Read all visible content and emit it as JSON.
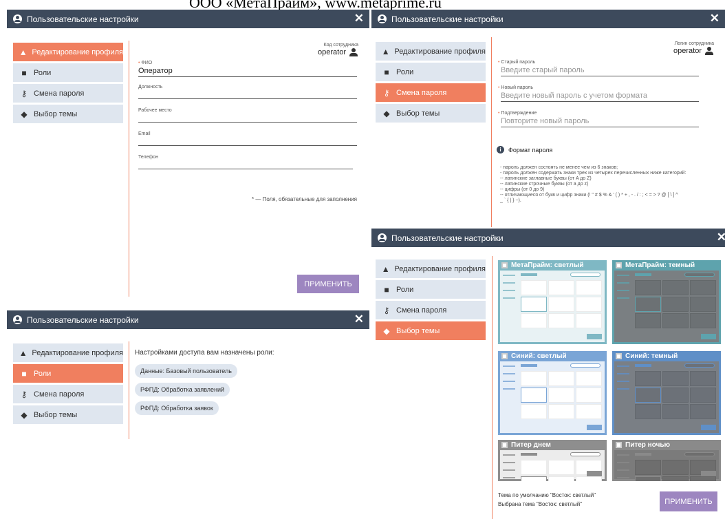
{
  "caption": "ООО «МетаПрайм», www.metaprime.ru",
  "window_title": "Пользовательские настройки",
  "menu": [
    "Редактирование профиля",
    "Роли",
    "Смена пароля",
    "Выбор темы"
  ],
  "icons": {
    "profile": "user-edit-icon",
    "roles": "roles-icon",
    "password": "key-icon",
    "theme": "paint-bucket-icon",
    "close": "close-icon",
    "window": "user-circle-icon",
    "info": "info-icon",
    "user": "user-icon"
  },
  "colors": {
    "titlebar": "#3d4a5c",
    "active": "#f07f5f",
    "menu": "#dfe6ef",
    "apply": "#9d86c0"
  },
  "profile": {
    "code_label": "Код сотрудника",
    "code_value": "operator",
    "fio_label": "ФИО",
    "fio_value": "Оператор",
    "position_label": "Должность",
    "workplace_label": "Рабочее место",
    "email_label": "Email",
    "phone_label": "Телефон",
    "required_note": "* — Поля, обязательные для заполнения",
    "apply": "ПРИМЕНИТЬ"
  },
  "roles": {
    "heading": "Настройками доступа вам назначены роли:",
    "items": [
      "Данные: Базовый пользователь",
      "РФПД: Обработка заявлений",
      "РФПД: Обработка заявок"
    ]
  },
  "password": {
    "login_label": "Логин сотрудника",
    "login_value": "operator",
    "old_label": "Старый пароль",
    "old_placeholder": "Введите старый пароль",
    "new_label": "Новый пароль",
    "new_placeholder": "Введите новый пароль с учетом формата",
    "confirm_label": "Подтверждение",
    "confirm_placeholder": "Повторите новый пароль",
    "format_title": "Формат пароля",
    "rules": [
      "- пароль должен состоять не менее чем из 6 знаков;",
      "- пароль должен содержать знаки трех из четырех перечисленных ниже категорий:",
      "-- латинские заглавные буквы (от A до Z)",
      "-- латинские строчные буквы (от a до z)",
      "-- цифры (от 0 до 9)",
      "-- отличающиеся от букв и цифр знаки (! \" # $ % & ' ( ) * + , - . / : ; < = > ? @ [ \\ ] ^",
      "_ ` { | } ~)."
    ]
  },
  "themes": {
    "items": [
      {
        "name": "МетаПрайм: светлый",
        "header": "#7fb8c4",
        "body": "#e8f2f4",
        "cell": "#ffffff"
      },
      {
        "name": "МетаПрайм: темный",
        "header": "#5ea3ad",
        "body": "#7a7f82",
        "cell": "#6c7174"
      },
      {
        "name": "Синий: светлый",
        "header": "#7aa5d6",
        "body": "#e6eef8",
        "cell": "#ffffff"
      },
      {
        "name": "Синий: темный",
        "header": "#5f8fc7",
        "body": "#7a7f85",
        "cell": "#6c7178"
      },
      {
        "name": "Питер днем",
        "header": "#8e8e8e",
        "body": "#ececec",
        "cell": "#ffffff"
      },
      {
        "name": "Питер ночью",
        "header": "#8a8a8a",
        "body": "#7b7b7b",
        "cell": "#6e6e6e"
      }
    ],
    "default_text": "Тема по умолчанию \"Восток: светлый\"",
    "selected_text": "Выбрана тема \"Восток: светлый\"",
    "apply": "ПРИМЕНИТЬ"
  }
}
